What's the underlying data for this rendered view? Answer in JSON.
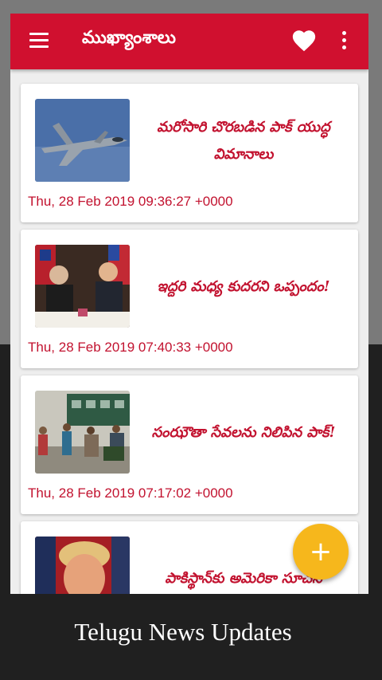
{
  "app": {
    "title": "ముఖ్యాంశాలు",
    "icons": {
      "menu": "hamburger-menu-icon",
      "favorites": "heart-icon",
      "more": "more-vert-icon"
    },
    "accent_color": "#d0102f"
  },
  "articles": [
    {
      "headline": "మరోసారి చొరబడిన పాక్ యుద్ధ విమానాలు",
      "date": "Thu, 28 Feb 2019 09:36:27 +0000",
      "image": "fighter-jet-photo"
    },
    {
      "headline": "ఇద్దరి మధ్య కుదరని ఒప్పందం!",
      "date": "Thu, 28 Feb 2019 07:40:33 +0000",
      "image": "leaders-summit-photo"
    },
    {
      "headline": "సంఝౌతా సేవలను నిలిపిన పాక్!",
      "date": "Thu, 28 Feb 2019 07:17:02 +0000",
      "image": "train-platform-photo"
    },
    {
      "headline": "పాకిస్థాన్‌కు అమెరికా సూచన",
      "date": "",
      "image": "politician-portrait-photo"
    }
  ],
  "fab": {
    "label": "+",
    "icon": "add-icon",
    "color": "#f6b71c"
  },
  "caption": "Telugu News Updates"
}
